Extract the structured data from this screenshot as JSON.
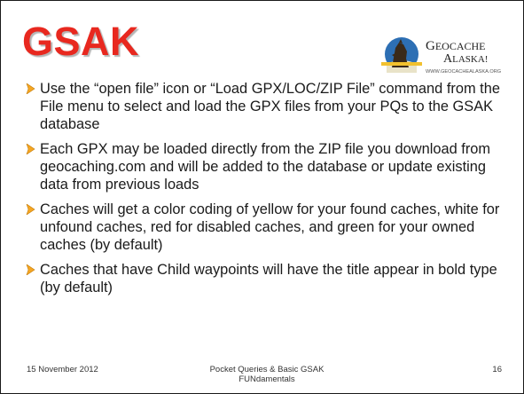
{
  "slide": {
    "title": "GSAK",
    "logo": {
      "name": "Geocache Alaska! logo",
      "line1": "GEOCACHE",
      "line2": "ALASKA!",
      "url_text": "WWW.GEOCACHEALASKA.ORG"
    },
    "bullets": [
      "Use the “open file” icon or “Load GPX/LOC/ZIP File” command from the File menu to select and load the GPX files from your PQs to the GSAK database",
      "Each GPX may be loaded directly from the ZIP file you download from geocaching.com and will be added to the database or update existing data from previous loads",
      "Caches will get a color coding of yellow for your found caches, white for unfound caches, red for disabled caches, and green for your owned caches (by default)",
      "Caches that have Child waypoints will have the title appear in bold type (by default)"
    ],
    "footer": {
      "date": "15 November  2012",
      "center_line1": "Pocket Queries & Basic GSAK",
      "center_line2": "FUNdamentals",
      "page": "16"
    }
  },
  "colors": {
    "title": "#e8281f",
    "bullet_arrow": "#f5a623",
    "text": "#1a1a1a"
  }
}
